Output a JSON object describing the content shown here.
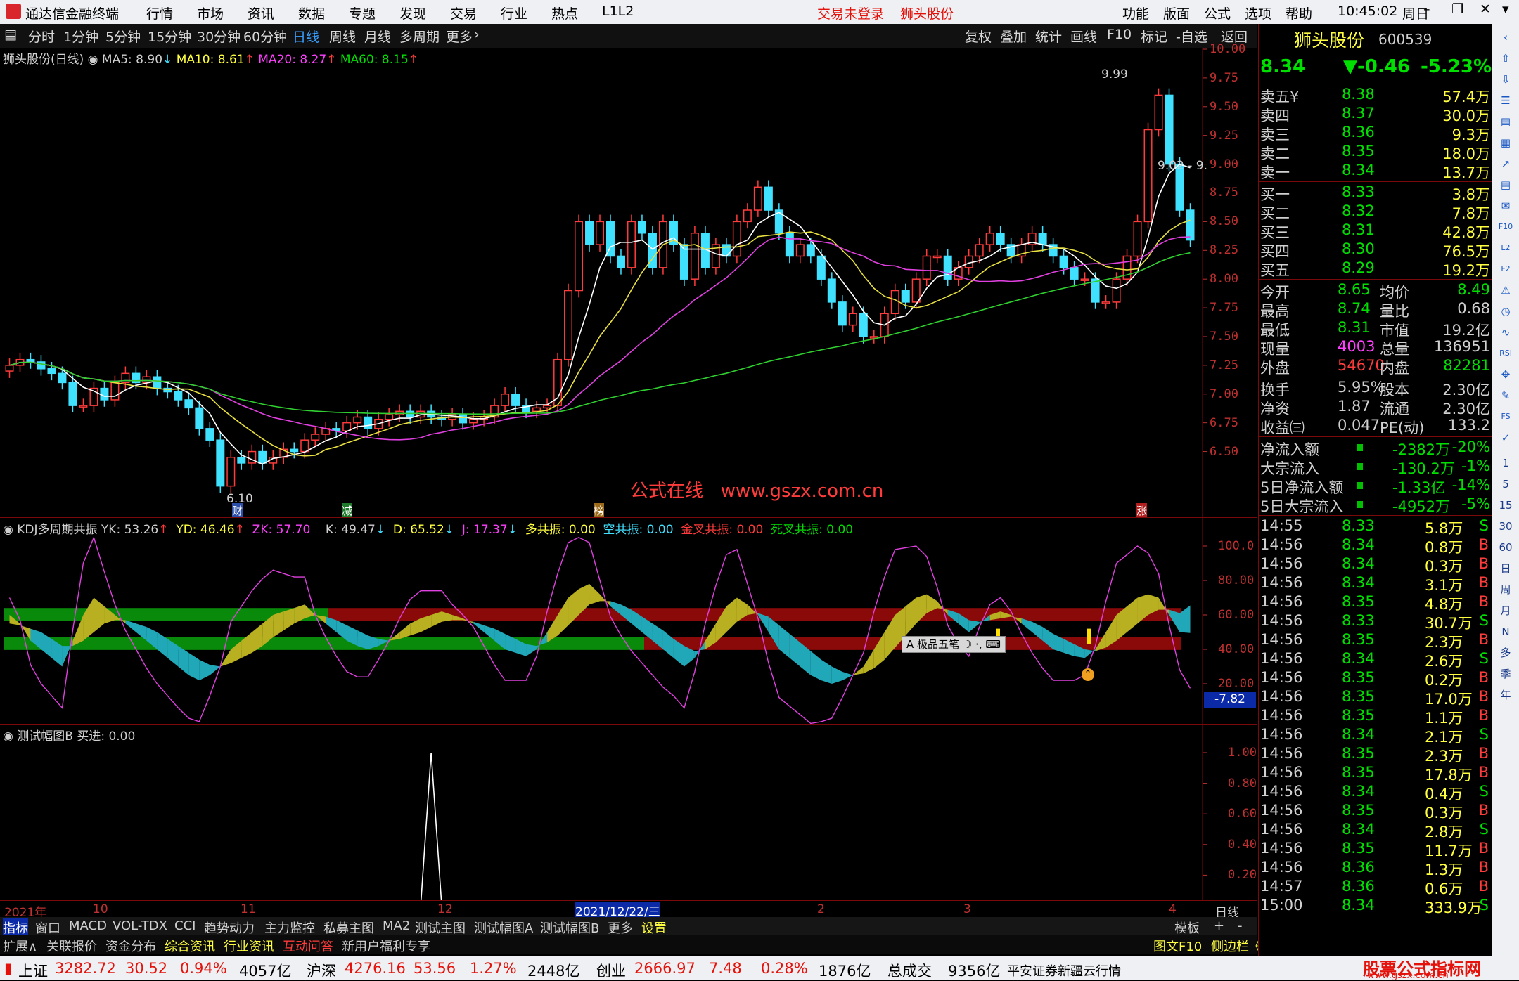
{
  "title_bar": {
    "app_name": "通达信金融终端",
    "menu": [
      "行情",
      "市场",
      "资讯",
      "数据",
      "专题",
      "发现",
      "交易",
      "行业",
      "热点",
      "L1L2"
    ],
    "trade_status": "交易未登录",
    "stock_name": "狮头股份",
    "right_menu": [
      "功能",
      "版面",
      "公式",
      "选项",
      "帮助"
    ],
    "time": "10:45:02",
    "weekday": "周日"
  },
  "period_bar": {
    "periods": [
      "分时",
      "1分钟",
      "5分钟",
      "15分钟",
      "30分钟",
      "60分钟",
      "日线",
      "周线",
      "月线",
      "多周期",
      "更多"
    ],
    "active": "日线",
    "tools": [
      "复权",
      "叠加",
      "统计",
      "画线",
      "F10",
      "标记",
      "-自选",
      "返回"
    ]
  },
  "price_chart": {
    "legend_title": "狮头股份(日线)",
    "ma5": "MA5: 8.90",
    "ma10": "MA10: 8.61",
    "ma20": "MA20: 8.27",
    "ma60": "MA60: 8.15",
    "high_label": "9.99",
    "range_label": "9.02 - 9.",
    "low_label": "6.10",
    "watermark": "公式在线   www.gszx.com.cn",
    "markers": [
      "财",
      "减",
      "榜",
      "涨"
    ],
    "y_ticks": [
      "10.00",
      "9.75",
      "9.50",
      "9.25",
      "9.00",
      "8.75",
      "8.50",
      "8.25",
      "8.00",
      "7.75",
      "7.50",
      "7.25",
      "7.00",
      "6.75",
      "6.50"
    ]
  },
  "kdj_chart": {
    "title": "KDJ多周期共振",
    "yk": "YK: 53.26",
    "yd": "YD: 46.46",
    "zk": "ZK: 57.70",
    "k": "K: 49.47",
    "d": "D: 65.52",
    "j": "J: 17.37",
    "duo": "多共振: 0.00",
    "kong": "空共振: 0.00",
    "jincha": "金叉共振: 0.00",
    "sicha": "死叉共振: 0.00",
    "y_ticks": [
      "100.0",
      "80.00",
      "60.00",
      "40.00",
      "20.00"
    ],
    "current_value": "-7.82",
    "ime_text": "极品五笔"
  },
  "test_chart": {
    "title": "测试幅图B",
    "value": "买进: 0.00",
    "y_ticks": [
      "1.00",
      "0.80",
      "0.60",
      "0.40",
      "0.20"
    ]
  },
  "x_axis": {
    "labels": [
      "2021年",
      "10",
      "11",
      "12",
      "2021/12/22/三",
      "2",
      "3",
      "4"
    ],
    "period": "日线"
  },
  "bottom_tabs": {
    "row1": [
      "指标",
      "窗口",
      "MACD",
      "VOL-TDX",
      "CCI",
      "趋势动力",
      "主力监控",
      "私募主图",
      "MA2",
      "测试主图",
      "测试幅图A",
      "测试幅图B",
      "更多",
      "设置"
    ],
    "row1_right": [
      "模板",
      "+",
      "-"
    ],
    "row2": [
      "扩展∧",
      "关联报价",
      "资金分布",
      "综合资讯",
      "行业资讯",
      "互动问答",
      "新用户福利专享"
    ],
    "row2_right": [
      "图文F10",
      "侧边栏《",
      "笔",
      "价",
      "细",
      "势",
      "联"
    ]
  },
  "quote_panel": {
    "name": "狮头股份",
    "code": "600539",
    "price": "8.34",
    "change": "▼-0.46",
    "change_pct": "-5.23%",
    "asks": [
      {
        "label": "卖五¥",
        "price": "8.38",
        "vol": "57.4万"
      },
      {
        "label": "卖四",
        "price": "8.37",
        "vol": "30.0万"
      },
      {
        "label": "卖三",
        "price": "8.36",
        "vol": "9.3万"
      },
      {
        "label": "卖二",
        "price": "8.35",
        "vol": "18.0万"
      },
      {
        "label": "卖一",
        "price": "8.34",
        "vol": "13.7万"
      }
    ],
    "bids": [
      {
        "label": "买一",
        "price": "8.33",
        "vol": "3.8万"
      },
      {
        "label": "买二",
        "price": "8.32",
        "vol": "7.8万"
      },
      {
        "label": "买三",
        "price": "8.31",
        "vol": "42.8万"
      },
      {
        "label": "买四",
        "price": "8.30",
        "vol": "76.5万"
      },
      {
        "label": "买五",
        "price": "8.29",
        "vol": "19.2万"
      }
    ],
    "stats": [
      {
        "l1": "今开",
        "v1": "8.65",
        "l2": "均价",
        "v2": "8.49"
      },
      {
        "l1": "最高",
        "v1": "8.74",
        "l2": "量比",
        "v2": "0.68"
      },
      {
        "l1": "最低",
        "v1": "8.31",
        "l2": "市值",
        "v2": "19.2亿"
      },
      {
        "l1": "现量",
        "v1": "4003",
        "l2": "总量",
        "v2": "136951"
      },
      {
        "l1": "外盘",
        "v1": "54670",
        "l2": "内盘",
        "v2": "82281"
      }
    ],
    "stats2": [
      {
        "l1": "换手",
        "v1": "5.95%",
        "l2": "股本",
        "v2": "2.30亿"
      },
      {
        "l1": "净资",
        "v1": "1.87",
        "l2": "流通",
        "v2": "2.30亿"
      },
      {
        "l1": "收益㈢",
        "v1": "0.047",
        "l2": "PE(动)",
        "v2": "133.2"
      }
    ],
    "flows": [
      {
        "label": "净流入额",
        "val": "-2382万",
        "pct": "-20%"
      },
      {
        "label": "大宗流入",
        "val": "-130.2万",
        "pct": "-1%"
      },
      {
        "label": "5日净流入额",
        "val": "-1.33亿",
        "pct": "-14%"
      },
      {
        "label": "5日大宗流入",
        "val": "-4952万",
        "pct": "-5%"
      }
    ],
    "ticks": [
      {
        "t": "14:55",
        "p": "8.33",
        "v": "5.8万",
        "s": "S"
      },
      {
        "t": "14:56",
        "p": "8.34",
        "v": "0.8万",
        "s": "B"
      },
      {
        "t": "14:56",
        "p": "8.34",
        "v": "0.3万",
        "s": "B"
      },
      {
        "t": "14:56",
        "p": "8.34",
        "v": "3.1万",
        "s": "B"
      },
      {
        "t": "14:56",
        "p": "8.35",
        "v": "4.8万",
        "s": "B"
      },
      {
        "t": "14:56",
        "p": "8.33",
        "v": "30.7万",
        "s": "S"
      },
      {
        "t": "14:56",
        "p": "8.35",
        "v": "2.3万",
        "s": "B"
      },
      {
        "t": "14:56",
        "p": "8.34",
        "v": "2.6万",
        "s": "S"
      },
      {
        "t": "14:56",
        "p": "8.35",
        "v": "0.2万",
        "s": "B"
      },
      {
        "t": "14:56",
        "p": "8.35",
        "v": "17.0万",
        "s": "B"
      },
      {
        "t": "14:56",
        "p": "8.35",
        "v": "1.1万",
        "s": "B"
      },
      {
        "t": "14:56",
        "p": "8.34",
        "v": "2.1万",
        "s": "S"
      },
      {
        "t": "14:56",
        "p": "8.35",
        "v": "2.3万",
        "s": "B"
      },
      {
        "t": "14:56",
        "p": "8.35",
        "v": "17.8万",
        "s": "B"
      },
      {
        "t": "14:56",
        "p": "8.34",
        "v": "0.4万",
        "s": "S"
      },
      {
        "t": "14:56",
        "p": "8.35",
        "v": "0.3万",
        "s": "B"
      },
      {
        "t": "14:56",
        "p": "8.34",
        "v": "2.8万",
        "s": "S"
      },
      {
        "t": "14:56",
        "p": "8.35",
        "v": "11.7万",
        "s": "B"
      },
      {
        "t": "14:56",
        "p": "8.36",
        "v": "1.3万",
        "s": "B"
      },
      {
        "t": "14:57",
        "p": "8.36",
        "v": "0.6万",
        "s": "B"
      },
      {
        "t": "15:00",
        "p": "8.34",
        "v": "333.9万",
        "s": "S"
      }
    ]
  },
  "status_bar": {
    "items": [
      {
        "name": "上证",
        "val": "3282.72",
        "chg": "30.52",
        "pct": "0.94%",
        "amt": "4057亿"
      },
      {
        "name": "沪深",
        "val": "4276.16",
        "chg": "53.56",
        "pct": "1.27%",
        "amt": "2448亿"
      },
      {
        "name": "创业",
        "val": "2666.97",
        "chg": "7.48",
        "pct": "0.28%",
        "amt": "1876亿"
      }
    ],
    "total_label": "总成交",
    "total": "9356亿",
    "broker": "平安证券新疆云行情",
    "brand": "股票公式指标网",
    "brand_url": "www.gszx.com.cn"
  },
  "sidebar": {
    "icons": [
      "collapse-icon",
      "up-icon",
      "down-icon",
      "menu-icon",
      "list-icon",
      "grid-icon",
      "chart-icon",
      "kline-icon",
      "news-icon",
      "f10-icon",
      "l2-icon",
      "f2-icon",
      "alert-icon",
      "clock-icon",
      "wave-icon",
      "rsi-icon",
      "move-icon",
      "pen-icon",
      "fs-icon",
      "tick-icon"
    ],
    "periods": [
      "1",
      "5",
      "15",
      "30",
      "60",
      "日",
      "周",
      "月",
      "N",
      "多",
      "季",
      "年"
    ]
  },
  "chart_data": [
    {
      "type": "candlestick",
      "title": "狮头股份(日线)",
      "ylim": [
        6.1,
        10.0
      ],
      "open": [
        7.2,
        7.25,
        7.3,
        7.28,
        7.22,
        7.18,
        7.1,
        6.9,
        6.9,
        7.05,
        6.95,
        7.1,
        7.18,
        7.1,
        7.15,
        7.05,
        7.02,
        6.95,
        6.88,
        6.7,
        6.6,
        6.2,
        6.45,
        6.4,
        6.5,
        6.4,
        6.45,
        6.52,
        6.5,
        6.6,
        6.65,
        6.7,
        6.68,
        6.75,
        6.8,
        6.7,
        6.78,
        6.82,
        6.85,
        6.8,
        6.85,
        6.8,
        6.78,
        6.82,
        6.75,
        6.78,
        6.8,
        6.9,
        7.0,
        6.9,
        6.85,
        6.88,
        6.9,
        7.3,
        7.9,
        8.5,
        8.3,
        8.5,
        8.2,
        8.1,
        8.5,
        8.4,
        8.1,
        8.5,
        8.3,
        8.0,
        8.4,
        8.1,
        8.3,
        8.2,
        8.5,
        8.6,
        8.8,
        8.6,
        8.4,
        8.2,
        8.3,
        8.2,
        8.0,
        7.8,
        7.6,
        7.7,
        7.5,
        7.5,
        7.7,
        7.9,
        7.8,
        8.0,
        8.2,
        8.2,
        8.0,
        8.1,
        8.2,
        8.3,
        8.4,
        8.3,
        8.2,
        8.3,
        8.4,
        8.3,
        8.2,
        8.1,
        8.0,
        8.0,
        7.8,
        7.8,
        8.0,
        8.2,
        8.5,
        9.3,
        9.6,
        9.0,
        8.6
      ],
      "close": [
        7.25,
        7.3,
        7.28,
        7.22,
        7.18,
        7.1,
        6.9,
        6.9,
        7.05,
        6.95,
        7.1,
        7.18,
        7.1,
        7.15,
        7.05,
        7.02,
        6.95,
        6.88,
        6.7,
        6.6,
        6.2,
        6.45,
        6.4,
        6.5,
        6.4,
        6.45,
        6.52,
        6.5,
        6.6,
        6.65,
        6.7,
        6.68,
        6.75,
        6.8,
        6.7,
        6.78,
        6.82,
        6.85,
        6.8,
        6.85,
        6.8,
        6.78,
        6.82,
        6.75,
        6.78,
        6.8,
        6.9,
        7.0,
        6.9,
        6.85,
        6.88,
        6.9,
        7.3,
        7.9,
        8.5,
        8.3,
        8.5,
        8.2,
        8.1,
        8.5,
        8.4,
        8.1,
        8.5,
        8.3,
        8.0,
        8.4,
        8.1,
        8.3,
        8.2,
        8.5,
        8.6,
        8.8,
        8.6,
        8.4,
        8.2,
        8.3,
        8.2,
        8.0,
        7.8,
        7.6,
        7.7,
        7.5,
        7.5,
        7.7,
        7.9,
        7.8,
        8.0,
        8.2,
        8.2,
        8.0,
        8.1,
        8.2,
        8.3,
        8.4,
        8.3,
        8.2,
        8.3,
        8.4,
        8.3,
        8.2,
        8.1,
        8.0,
        8.0,
        7.8,
        7.8,
        8.0,
        8.2,
        8.5,
        9.3,
        9.6,
        9.0,
        8.6,
        8.34
      ]
    },
    {
      "type": "line",
      "title": "KDJ多周期共振",
      "ylim": [
        0,
        100
      ],
      "series": [
        {
          "name": "K",
          "values": [
            60,
            55,
            45,
            40,
            35,
            30,
            45,
            60,
            70,
            65,
            60,
            55,
            50,
            45,
            40,
            35,
            30,
            25,
            22,
            25,
            30,
            40,
            45,
            50,
            55,
            60,
            62,
            64,
            66,
            60,
            55,
            50,
            45,
            42,
            40,
            42,
            45,
            50,
            55,
            58,
            60,
            62,
            60,
            58,
            55,
            50,
            45,
            40,
            38,
            36,
            40,
            50,
            60,
            70,
            75,
            78,
            72,
            65,
            60,
            55,
            50,
            45,
            40,
            35,
            30,
            35,
            45,
            55,
            65,
            70,
            66,
            60,
            50,
            40,
            35,
            30,
            25,
            22,
            20,
            22,
            25,
            30,
            40,
            50,
            60,
            65,
            70,
            72,
            68,
            60,
            55,
            50,
            55,
            60,
            62,
            60,
            55,
            50,
            45,
            40,
            38,
            36,
            35,
            40,
            50,
            60,
            65,
            70,
            72,
            70,
            60,
            50,
            49.47
          ]
        },
        {
          "name": "D",
          "values": [
            55,
            54,
            52,
            50,
            46,
            42,
            42,
            45,
            50,
            55,
            57,
            57,
            55,
            53,
            50,
            46,
            42,
            38,
            34,
            31,
            30,
            32,
            35,
            38,
            42,
            47,
            51,
            55,
            58,
            60,
            59,
            57,
            54,
            51,
            48,
            46,
            45,
            46,
            48,
            50,
            53,
            56,
            57,
            57,
            56,
            54,
            52,
            49,
            46,
            43,
            42,
            44,
            48,
            54,
            60,
            66,
            68,
            68,
            66,
            63,
            59,
            55,
            51,
            46,
            42,
            39,
            40,
            44,
            50,
            56,
            60,
            61,
            59,
            54,
            49,
            44,
            39,
            34,
            30,
            27,
            25,
            26,
            29,
            34,
            41,
            48,
            55,
            61,
            64,
            63,
            61,
            57,
            56,
            57,
            58,
            59,
            58,
            56,
            53,
            49,
            46,
            43,
            40,
            39,
            41,
            45,
            50,
            55,
            60,
            63,
            63,
            61,
            65.52
          ]
        },
        {
          "name": "J",
          "values": [
            70,
            57,
            31,
            20,
            13,
            6,
            51,
            90,
            110,
            85,
            66,
            51,
            40,
            29,
            20,
            13,
            6,
            0,
            -2,
            13,
            30,
            56,
            65,
            74,
            81,
            86,
            84,
            82,
            82,
            60,
            47,
            36,
            27,
            24,
            24,
            34,
            45,
            58,
            69,
            74,
            74,
            74,
            66,
            60,
            53,
            42,
            31,
            22,
            22,
            22,
            36,
            62,
            84,
            102,
            105,
            102,
            80,
            59,
            48,
            39,
            32,
            25,
            18,
            13,
            6,
            27,
            55,
            77,
            95,
            98,
            78,
            58,
            32,
            12,
            7,
            2,
            -3,
            -2,
            0,
            12,
            25,
            38,
            62,
            82,
            98,
            99,
            100,
            94,
            76,
            54,
            43,
            36,
            53,
            66,
            70,
            62,
            49,
            38,
            29,
            22,
            22,
            22,
            25,
            42,
            68,
            90,
            95,
            100,
            96,
            84,
            54,
            28,
            17.37
          ]
        }
      ]
    },
    {
      "type": "line",
      "title": "测试幅图B",
      "ylim": [
        0,
        1
      ],
      "series": [
        {
          "name": "买进",
          "values": [
            0,
            0,
            0,
            0,
            0,
            0,
            0,
            0,
            0,
            0,
            0,
            0,
            0,
            0,
            0,
            0,
            0,
            0,
            0,
            0,
            0,
            0,
            0,
            0,
            0,
            0,
            0,
            0,
            0,
            0,
            0,
            0,
            0,
            0,
            0,
            0,
            0,
            0,
            0,
            0,
            1,
            0,
            0,
            0,
            0,
            0,
            0,
            0,
            0,
            0,
            0,
            0,
            0,
            0,
            0,
            0,
            0,
            0,
            0,
            0,
            0,
            0,
            0,
            0,
            0,
            0,
            0,
            0,
            0,
            0,
            0,
            0,
            0,
            0,
            0,
            0,
            0,
            0,
            0,
            0,
            0,
            0,
            0,
            0,
            0,
            0,
            0,
            0,
            0,
            0,
            0,
            0,
            0,
            0,
            0,
            0,
            0,
            0,
            0,
            0,
            0,
            0,
            0,
            0,
            0,
            0,
            0,
            0,
            0,
            0,
            0,
            0,
            0
          ]
        }
      ]
    }
  ]
}
